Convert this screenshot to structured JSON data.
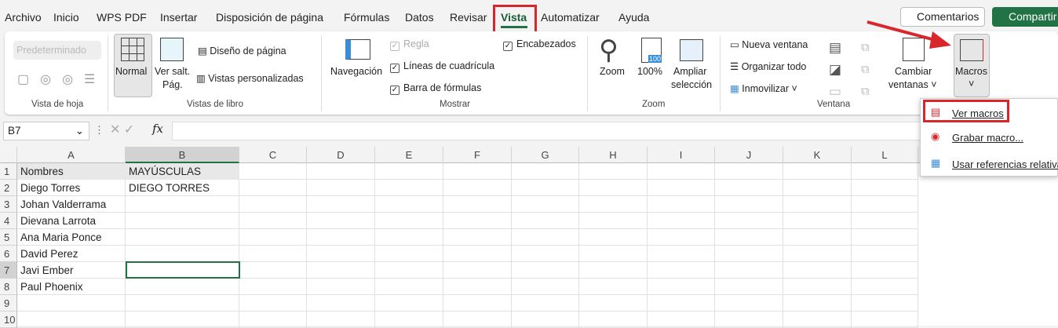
{
  "menu": [
    "Archivo",
    "Inicio",
    "WPS PDF",
    "Insertar",
    "Disposición de página",
    "Fórmulas",
    "Datos",
    "Revisar",
    "Vista",
    "Automatizar",
    "Ayuda"
  ],
  "comments": "Comentarios",
  "share": "Compartir",
  "ribbon": {
    "sheet_view_select": "Predeterminado",
    "g_sheet": "Vista de hoja",
    "normal": "Normal",
    "page_break": "Ver salt.",
    "page_break2": "Pág.",
    "page_layout": "Diseño de página",
    "custom_views": "Vistas personalizadas",
    "g_book": "Vistas de libro",
    "navigation": "Navegación",
    "ruler": "Regla",
    "gridlines": "Líneas de cuadrícula",
    "formula_bar": "Barra de fórmulas",
    "headings": "Encabezados",
    "g_show": "Mostrar",
    "zoom": "Zoom",
    "zoom100": "100%",
    "zoom_sel": "Ampliar",
    "zoom_sel2": "selección",
    "g_zoom": "Zoom",
    "badge100": "100",
    "new_window": "Nueva ventana",
    "arrange_all": "Organizar todo",
    "freeze": "Inmovilizar",
    "switch": "Cambiar",
    "switch2": "ventanas",
    "g_window": "Ventana",
    "macros": "Macros"
  },
  "namebox": "B7",
  "fx": "fx",
  "columns": [
    "A",
    "B",
    "C",
    "D",
    "E",
    "F",
    "G",
    "H",
    "I",
    "J",
    "K",
    "L"
  ],
  "rows": [
    "1",
    "2",
    "3",
    "4",
    "5",
    "6",
    "7",
    "8",
    "9",
    "10"
  ],
  "cells": {
    "A": [
      "Nombres",
      "Diego Torres",
      "Johan Valderrama",
      "Dievana Larrota",
      "Ana Maria Ponce",
      "David Perez",
      "Javi Ember",
      "Paul Phoenix"
    ],
    "B": [
      "MAYÚSCULAS",
      "DIEGO TORRES"
    ]
  },
  "dropdown": [
    "Ver macros",
    "Grabar macro...",
    "Usar referencias relativas"
  ],
  "accent": "#217346",
  "highlight": "#d9262b"
}
